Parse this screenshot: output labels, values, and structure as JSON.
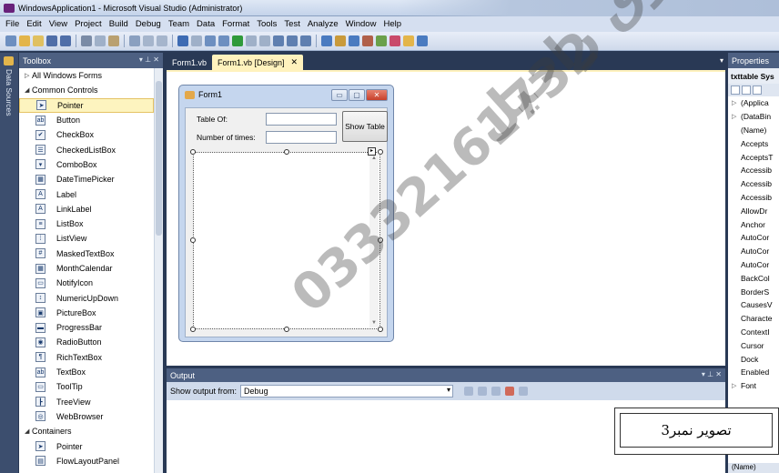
{
  "window": {
    "title": "WindowsApplication1 - Microsoft Visual Studio (Administrator)"
  },
  "menu": [
    "File",
    "Edit",
    "View",
    "Project",
    "Build",
    "Debug",
    "Team",
    "Data",
    "Format",
    "Tools",
    "Test",
    "Analyze",
    "Window",
    "Help"
  ],
  "data_sources_label": "Data Sources",
  "toolbox": {
    "title": "Toolbox",
    "controls": "▾ ⊥ ✕",
    "rows": [
      {
        "kind": "cat",
        "label": "All Windows Forms",
        "arrow": "▷"
      },
      {
        "kind": "cat",
        "label": "Common Controls",
        "arrow": "◢"
      },
      {
        "kind": "item",
        "label": "Pointer",
        "icon": "pointer-icon",
        "glyph": "➤",
        "selected": true
      },
      {
        "kind": "item",
        "label": "Button",
        "icon": "button-icon",
        "glyph": "ab"
      },
      {
        "kind": "item",
        "label": "CheckBox",
        "icon": "checkbox-icon",
        "glyph": "✔"
      },
      {
        "kind": "item",
        "label": "CheckedListBox",
        "icon": "checkedlistbox-icon",
        "glyph": "☰"
      },
      {
        "kind": "item",
        "label": "ComboBox",
        "icon": "combobox-icon",
        "glyph": "▾"
      },
      {
        "kind": "item",
        "label": "DateTimePicker",
        "icon": "datetimepicker-icon",
        "glyph": "▦"
      },
      {
        "kind": "item",
        "label": "Label",
        "icon": "label-icon",
        "glyph": "A"
      },
      {
        "kind": "item",
        "label": "LinkLabel",
        "icon": "linklabel-icon",
        "glyph": "A"
      },
      {
        "kind": "item",
        "label": "ListBox",
        "icon": "listbox-icon",
        "glyph": "≡"
      },
      {
        "kind": "item",
        "label": "ListView",
        "icon": "listview-icon",
        "glyph": "⁞"
      },
      {
        "kind": "item",
        "label": "MaskedTextBox",
        "icon": "maskedtextbox-icon",
        "glyph": "#"
      },
      {
        "kind": "item",
        "label": "MonthCalendar",
        "icon": "monthcalendar-icon",
        "glyph": "▦"
      },
      {
        "kind": "item",
        "label": "NotifyIcon",
        "icon": "notifyicon-icon",
        "glyph": "▭"
      },
      {
        "kind": "item",
        "label": "NumericUpDown",
        "icon": "numericupdown-icon",
        "glyph": "↕"
      },
      {
        "kind": "item",
        "label": "PictureBox",
        "icon": "picturebox-icon",
        "glyph": "▣"
      },
      {
        "kind": "item",
        "label": "ProgressBar",
        "icon": "progressbar-icon",
        "glyph": "▬"
      },
      {
        "kind": "item",
        "label": "RadioButton",
        "icon": "radiobutton-icon",
        "glyph": "◉"
      },
      {
        "kind": "item",
        "label": "RichTextBox",
        "icon": "richtextbox-icon",
        "glyph": "¶"
      },
      {
        "kind": "item",
        "label": "TextBox",
        "icon": "textbox-icon",
        "glyph": "ab"
      },
      {
        "kind": "item",
        "label": "ToolTip",
        "icon": "tooltip-icon",
        "glyph": "▭"
      },
      {
        "kind": "item",
        "label": "TreeView",
        "icon": "treeview-icon",
        "glyph": "┣"
      },
      {
        "kind": "item",
        "label": "WebBrowser",
        "icon": "webbrowser-icon",
        "glyph": "◎"
      },
      {
        "kind": "cat",
        "label": "Containers",
        "arrow": "◢"
      },
      {
        "kind": "item",
        "label": "Pointer",
        "icon": "pointer-icon",
        "glyph": "➤"
      },
      {
        "kind": "item",
        "label": "FlowLayoutPanel",
        "icon": "flowlayoutpanel-icon",
        "glyph": "▤"
      }
    ]
  },
  "tabs": [
    {
      "label": "Form1.vb"
    },
    {
      "label": "Form1.vb [Design]",
      "close": "✕"
    }
  ],
  "form": {
    "title": "Form1",
    "label_table_of": "Table Of:",
    "label_number_of_times": "Number of times:",
    "show_button": "Show Table",
    "min": "▭",
    "max": "▢",
    "close": "✕"
  },
  "output": {
    "title": "Output",
    "controls": "▾ ⊥ ✕",
    "show_output_from": "Show output from:",
    "source": "Debug"
  },
  "properties": {
    "title": "Properties",
    "object": "txttable Sys",
    "rows": [
      {
        "label": "(Applica",
        "expand": "▷"
      },
      {
        "label": "(DataBin",
        "expand": "▷"
      },
      {
        "label": "(Name)",
        "expand": ""
      },
      {
        "label": "Accepts",
        "expand": ""
      },
      {
        "label": "AcceptsT",
        "expand": ""
      },
      {
        "label": "Accessib",
        "expand": ""
      },
      {
        "label": "Accessib",
        "expand": ""
      },
      {
        "label": "Accessib",
        "expand": ""
      },
      {
        "label": "AllowDr",
        "expand": ""
      },
      {
        "label": "Anchor",
        "expand": ""
      },
      {
        "label": "AutoCor",
        "expand": ""
      },
      {
        "label": "AutoCor",
        "expand": ""
      },
      {
        "label": "AutoCor",
        "expand": ""
      },
      {
        "label": "BackCol",
        "expand": ""
      },
      {
        "label": "BorderS",
        "expand": ""
      },
      {
        "label": "CausesV",
        "expand": ""
      },
      {
        "label": "Characte",
        "expand": ""
      },
      {
        "label": "ContextI",
        "expand": ""
      },
      {
        "label": "Cursor",
        "expand": ""
      },
      {
        "label": "Dock",
        "expand": ""
      },
      {
        "label": "Enabled",
        "expand": ""
      },
      {
        "label": "Font",
        "expand": "▷"
      }
    ],
    "footer": "(Name)"
  },
  "caption": "تصویر نمبر3",
  "watermark_number": "03332161732",
  "watermark_urdu": "طارق راحیل"
}
